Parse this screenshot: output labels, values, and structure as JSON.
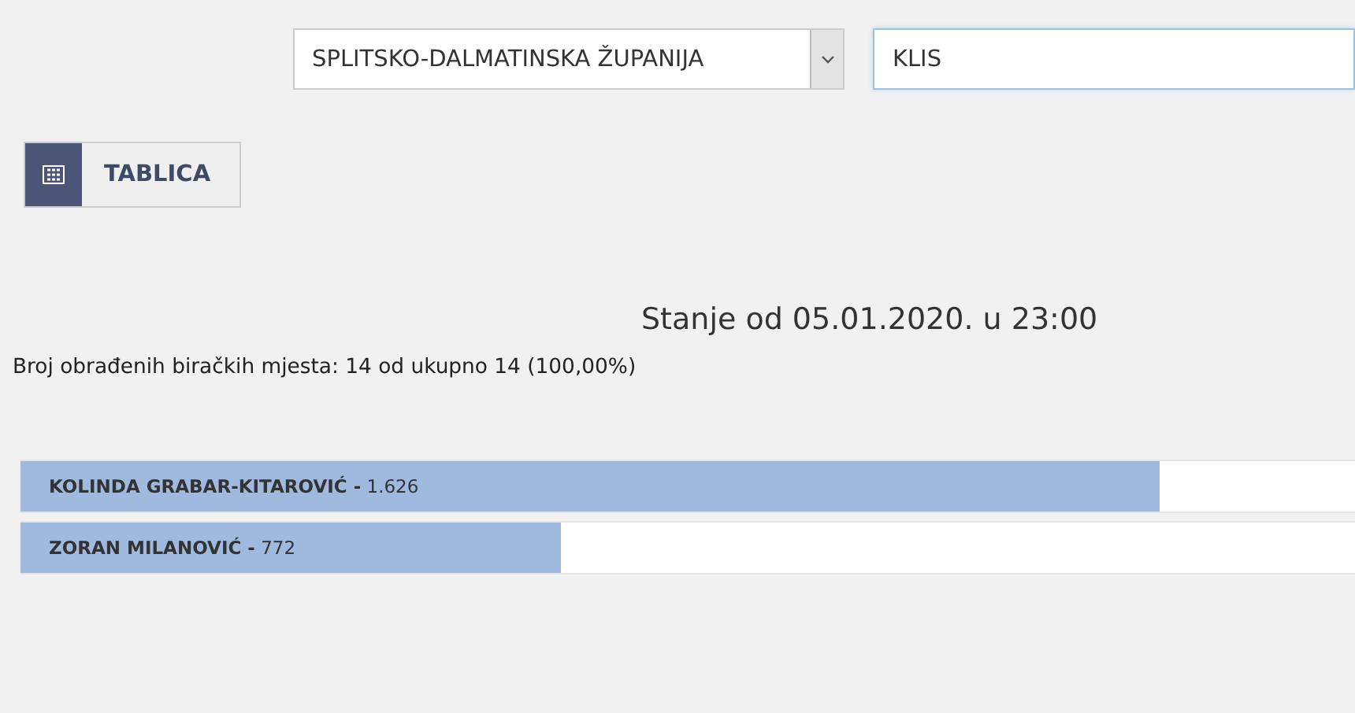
{
  "filters": {
    "county": {
      "value": "SPLITSKO-DALMATINSKA ŽUPANIJA"
    },
    "municipality": {
      "value": "KLIS"
    }
  },
  "view_button": {
    "label": "TABLICA"
  },
  "status": {
    "title": "Stanje od 05.01.2020. u 23:00",
    "processed": "Broj obrađenih biračkih mjesta: 14 od ukupno 14 (100,00%)"
  },
  "results": [
    {
      "label": "**KOLINDA GRABAR-KITAROVIĆ -** 1.626",
      "level": 0.854
    },
    {
      "label": "**ZORAN MILANOVIĆ -** 772",
      "level": 0.405
    }
  ]
}
